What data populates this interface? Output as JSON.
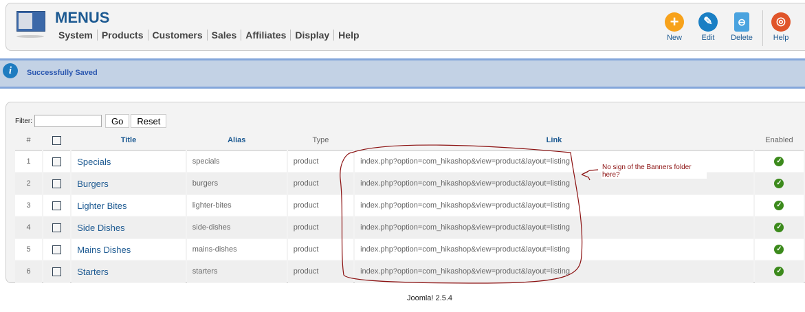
{
  "header": {
    "title": "MENUS",
    "nav": [
      "System",
      "Products",
      "Customers",
      "Sales",
      "Affiliates",
      "Display",
      "Help"
    ]
  },
  "toolbar": {
    "new": "New",
    "edit": "Edit",
    "delete": "Delete",
    "help": "Help"
  },
  "message": "Successfully Saved",
  "filter": {
    "label": "Filter:",
    "value": "",
    "go": "Go",
    "reset": "Reset"
  },
  "table": {
    "headers": [
      "#",
      "Title",
      "Alias",
      "Type",
      "Link",
      "Enabled"
    ],
    "rows": [
      {
        "n": "1",
        "title": "Specials",
        "alias": "specials",
        "type": "product",
        "link": "index.php?option=com_hikashop&view=product&layout=listing"
      },
      {
        "n": "2",
        "title": "Burgers",
        "alias": "burgers",
        "type": "product",
        "link": "index.php?option=com_hikashop&view=product&layout=listing"
      },
      {
        "n": "3",
        "title": "Lighter Bites",
        "alias": "lighter-bites",
        "type": "product",
        "link": "index.php?option=com_hikashop&view=product&layout=listing"
      },
      {
        "n": "4",
        "title": "Side Dishes",
        "alias": "side-dishes",
        "type": "product",
        "link": "index.php?option=com_hikashop&view=product&layout=listing"
      },
      {
        "n": "5",
        "title": "Mains Dishes",
        "alias": "mains-dishes",
        "type": "product",
        "link": "index.php?option=com_hikashop&view=product&layout=listing"
      },
      {
        "n": "6",
        "title": "Starters",
        "alias": "starters",
        "type": "product",
        "link": "index.php?option=com_hikashop&view=product&layout=listing"
      }
    ]
  },
  "annotation": "No sign of the Banners folder here?",
  "footer": "Joomla! 2.5.4"
}
